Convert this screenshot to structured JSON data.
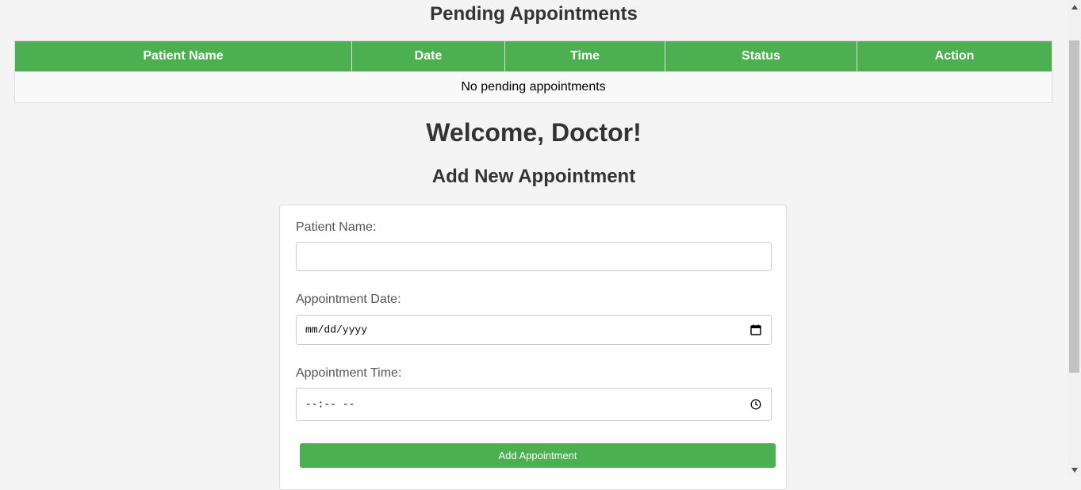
{
  "pending": {
    "title": "Pending Appointments",
    "columns": [
      "Patient Name",
      "Date",
      "Time",
      "Status",
      "Action"
    ],
    "empty_message": "No pending appointments"
  },
  "welcome": "Welcome, Doctor!",
  "form": {
    "title": "Add New Appointment",
    "patient_name_label": "Patient Name:",
    "patient_name_value": "",
    "date_label": "Appointment Date:",
    "date_placeholder": "mm/dd/yyyy",
    "time_label": "Appointment Time:",
    "time_placeholder": "--:-- --",
    "submit_label": "Add Appointment"
  },
  "icons": {
    "calendar": "calendar-icon",
    "clock": "clock-icon"
  },
  "colors": {
    "accent": "#4caf50",
    "background": "#f4f4f4"
  }
}
